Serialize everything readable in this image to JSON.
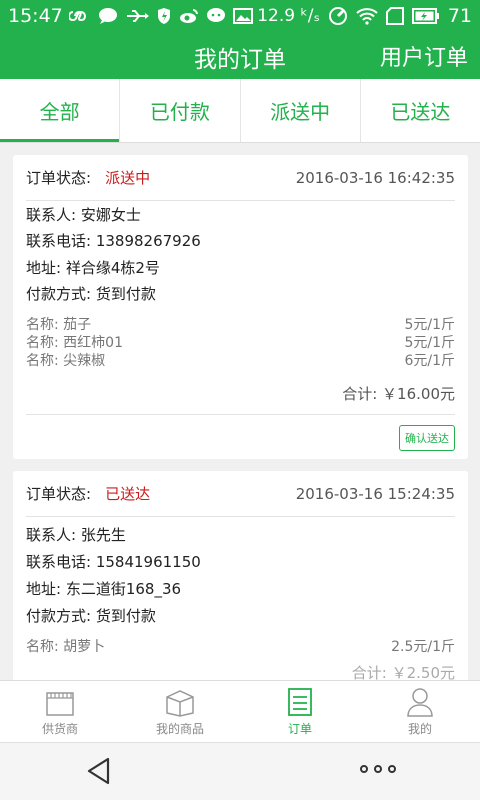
{
  "statusbar": {
    "time": "15:47",
    "speed": "12.9 ᵏ/ₛ",
    "battery": "71",
    "icons": [
      "infinity-icon",
      "chat-bubble-icon",
      "usb-icon",
      "shield-icon",
      "weibo-icon",
      "wechat-icon",
      "image-icon",
      "signal-icon",
      "wifi-icon",
      "sim-icon",
      "battery-icon"
    ]
  },
  "appbar": {
    "title": "我的订单",
    "action": "用户订单"
  },
  "tabs": [
    {
      "label": "全部",
      "active": true
    },
    {
      "label": "已付款",
      "active": false
    },
    {
      "label": "派送中",
      "active": false
    },
    {
      "label": "已送达",
      "active": false
    }
  ],
  "orders": [
    {
      "status_label": "订单状态:",
      "status": "派送中",
      "datetime": "2016-03-16 16:42:35",
      "contact": "联系人: 安娜女士",
      "phone": "联系电话: 13898267926",
      "address": "地址: 祥合缘4栋2号",
      "payment": "付款方式: 货到付款",
      "items": [
        {
          "name": "名称: 茄子",
          "price": "5元/1斤"
        },
        {
          "name": "名称: 西红柿01",
          "price": "5元/1斤"
        },
        {
          "name": "名称: 尖辣椒",
          "price": "6元/1斤"
        }
      ],
      "total": "合计: ￥16.00元",
      "action": "确认送达"
    },
    {
      "status_label": "订单状态:",
      "status": "已送达",
      "datetime": "2016-03-16 15:24:35",
      "contact": "联系人: 张先生",
      "phone": "联系电话: 15841961150",
      "address": "地址: 东二道街168_36",
      "payment": "付款方式: 货到付款",
      "items": [
        {
          "name": "名称: 胡萝卜",
          "price": "2.5元/1斤"
        }
      ],
      "total": "合计: ￥2.50元"
    }
  ],
  "bottomnav": [
    {
      "label": "供货商",
      "icon": "store-icon",
      "active": false
    },
    {
      "label": "我的商品",
      "icon": "box-icon",
      "active": false
    },
    {
      "label": "订单",
      "icon": "list-icon",
      "active": true
    },
    {
      "label": "我的",
      "icon": "user-icon",
      "active": false
    }
  ],
  "colors": {
    "primary": "#23b14d",
    "status_red": "#cc1b1b",
    "background": "#f0f0f0"
  }
}
